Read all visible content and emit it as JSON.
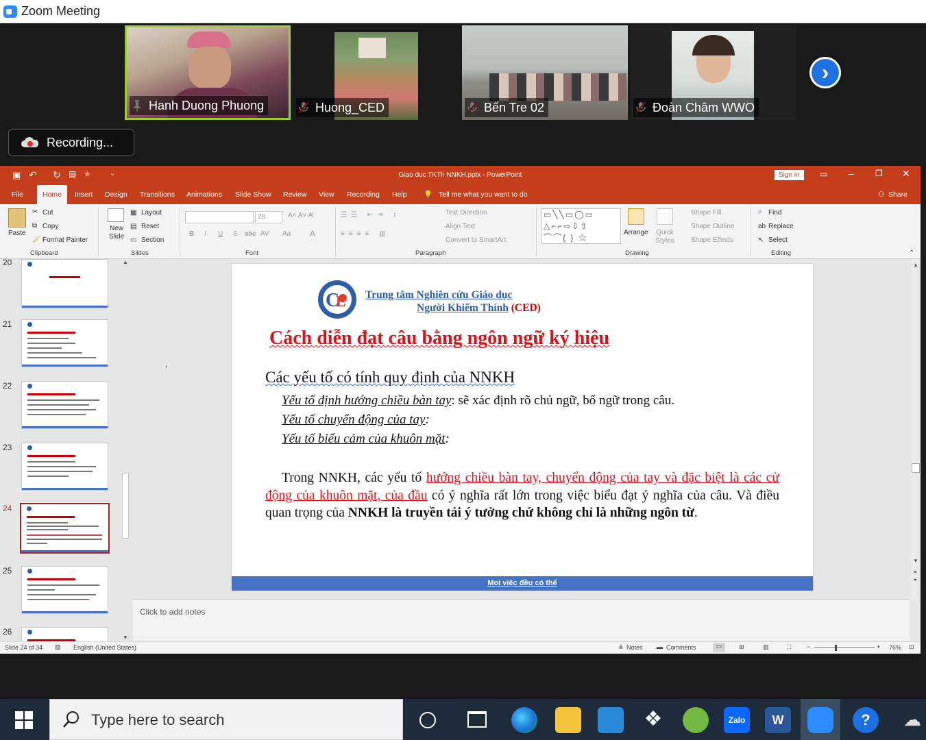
{
  "zoom": {
    "window_title": "Zoom Meeting",
    "participants": [
      {
        "name": "Hanh Duong Phuong",
        "muted": false,
        "icon": "pin-icon"
      },
      {
        "name": "Huong_CED",
        "muted": true,
        "icon": "mic-muted-icon"
      },
      {
        "name": "Bến Tre 02",
        "muted": true,
        "icon": "mic-muted-icon"
      },
      {
        "name": "Đoàn Châm WWO",
        "muted": true,
        "icon": "mic-muted-icon"
      }
    ],
    "recording_label": "Recording..."
  },
  "ppt": {
    "title": "Giao duc TKTh NNKH.pptx  -  PowerPoint",
    "sign_in": "Sign in",
    "tabs": [
      "File",
      "Home",
      "Insert",
      "Design",
      "Transitions",
      "Animations",
      "Slide Show",
      "Review",
      "View",
      "Recording",
      "Help"
    ],
    "active_tab": "Home",
    "tell_me": "Tell me what you want to do",
    "share": "Share",
    "ribbon": {
      "paste": "Paste",
      "cut": "Cut",
      "copy": "Copy",
      "format_painter": "Format Painter",
      "clipboard": "Clipboard",
      "new_slide": "New Slide",
      "layout": "Layout",
      "reset": "Reset",
      "section": "Section",
      "slides": "Slides",
      "font_size": "28",
      "font": "Font",
      "text_direction": "Text Direction",
      "align_text": "Align Text",
      "convert_smartart": "Convert to SmartArt",
      "paragraph": "Paragraph",
      "arrange": "Arrange",
      "quick_styles": "Quick Styles",
      "shape_fill": "Shape Fill",
      "shape_outline": "Shape Outline",
      "shape_effects": "Shape Effects",
      "drawing": "Drawing",
      "find": "Find",
      "replace": "Replace",
      "select": "Select",
      "editing": "Editing"
    },
    "thumbnails": [
      {
        "num": "20",
        "title": "Giới thiệu bài tập nhóm"
      },
      {
        "num": "21",
        "title": "Cách diễn đạt câu bằng ngôn ngữ ký hiệu"
      },
      {
        "num": "22",
        "title": "Cách diễn đạt câu bằng ngôn ngữ ký hiệu"
      },
      {
        "num": "23",
        "title": "Cách diễn đạt câu bằng ngôn ngữ ký hiệu"
      },
      {
        "num": "24",
        "title": "Cách diễn đạt câu bằng ngôn ngữ ký hiệu"
      },
      {
        "num": "25",
        "title": "Cách diễn đạt câu bằng ngôn ngữ ký hiệu"
      },
      {
        "num": "26",
        "title": "Cách diễn đạt câu bằng ngôn ngữ ký hiệu"
      }
    ],
    "selected_slide": "24",
    "slide": {
      "org_line1": "Trung tâm Nghiên cứu Giáo dục",
      "org_line2": "Người Khiếm Thính",
      "org_abbr": "(CED)",
      "title": "Cách diễn đạt câu bằng ngôn ngữ ký hiệu",
      "heading": "Các yếu tố có tính quy định của NNKH",
      "item1": "Yếu tố định hướng chiều bàn tay",
      "item1_rest": ":  sẽ xác định rõ chủ ngữ, bổ ngữ trong câu.",
      "item2": "Yếu tố chuyển động của tay",
      "item2_rest": ":",
      "item3": "Yếu tố biểu cảm của khuôn mặt",
      "item3_rest": ":",
      "para_a": "Trong NNKH, các yếu tố ",
      "para_red": "hướng chiều bàn tay, chuyển động của tay và đặc biệt là các cử động của khuôn mặt, của đầu",
      "para_b": " có ý nghĩa rất lớn trong việc biểu đạt ý nghĩa của câu. Và điều quan trọng của ",
      "para_bold": "NNKH là truyền tải ý tưởng chứ không chỉ là những ngôn từ",
      "para_end": ".",
      "footer": "Mọi việc đều có thể"
    },
    "notes_placeholder": "Click to add notes",
    "status": {
      "slide_count": "Slide 24 of 34",
      "language": "English (United States)",
      "notes": "Notes",
      "comments": "Comments",
      "zoom": "76%"
    }
  },
  "taskbar": {
    "search_placeholder": "Type here to search"
  }
}
